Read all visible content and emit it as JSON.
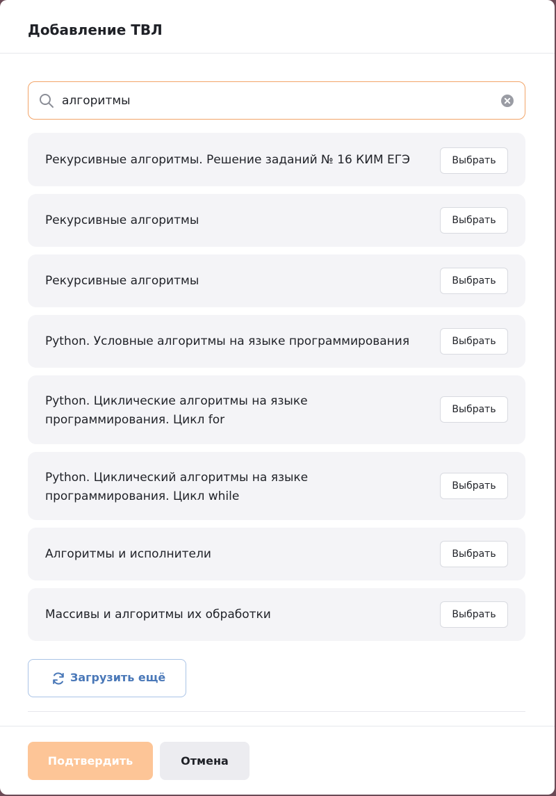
{
  "modal": {
    "title": "Добавление ТВЛ"
  },
  "search": {
    "value": "алгоритмы",
    "icon": "search-icon",
    "clear_icon": "clear-icon"
  },
  "results": [
    {
      "label": "Рекурсивные алгоритмы. Решение заданий № 16 КИМ ЕГЭ",
      "button": "Выбрать"
    },
    {
      "label": "Рекурсивные алгоритмы",
      "button": "Выбрать"
    },
    {
      "label": "Рекурсивные алгоритмы",
      "button": "Выбрать"
    },
    {
      "label": "Python. Условные алгоритмы на языке программирования",
      "button": "Выбрать"
    },
    {
      "label": "Python. Циклические алгоритмы на языке программирования. Цикл for",
      "button": "Выбрать"
    },
    {
      "label": "Python. Циклический алгоритмы на языке программирования. Цикл while",
      "button": "Выбрать"
    },
    {
      "label": "Алгоритмы и исполнители",
      "button": "Выбрать"
    },
    {
      "label": "Массивы и алгоритмы их обработки",
      "button": "Выбрать"
    }
  ],
  "load_more": {
    "label": "Загрузить ещё",
    "icon": "refresh-icon"
  },
  "footer": {
    "confirm_label": "Подтвердить",
    "cancel_label": "Отмена"
  },
  "colors": {
    "accent_border": "#f2a468",
    "confirm_disabled": "#fdc597",
    "link_blue": "#4a78b8",
    "item_bg": "#f4f4f7"
  }
}
